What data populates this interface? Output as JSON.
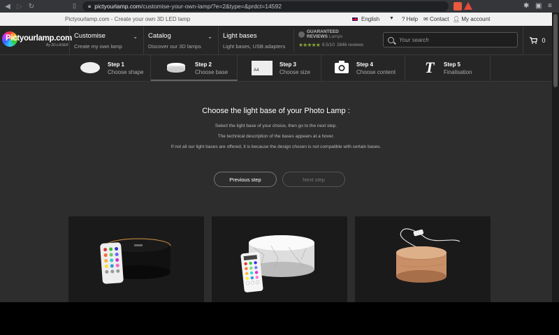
{
  "browser": {
    "url_host": "pictyourlamp.com",
    "url_path": "/customise-your-own-lamp/?e=2&type=&prdct=14592"
  },
  "topbar": {
    "tagline": "Pictyourlamp.com - Create your own 3D LED lamp",
    "language": "English",
    "help": "Help",
    "contact": "Contact",
    "account": "My account"
  },
  "header": {
    "logo": "Pictyourlamp.com",
    "logo_sub": "By 2D-LASER",
    "menus": [
      {
        "title": "Customise",
        "sub": "Create my own lamp"
      },
      {
        "title": "Catalog",
        "sub": "Discover our 3D lamps"
      },
      {
        "title": "Light bases",
        "sub": "Light bases, USB adapters"
      }
    ],
    "reviews": {
      "badge_line1": "GUARANTEED",
      "badge_line2": "REVIEWS",
      "brand": "Lamps",
      "score": "9.5/10",
      "count": "2846 reviews"
    },
    "search_placeholder": "Your search",
    "cart_count": "0"
  },
  "steps": [
    {
      "name": "Step 1",
      "desc": "Choose shape"
    },
    {
      "name": "Step 2",
      "desc": "Choose base"
    },
    {
      "name": "Step 3",
      "desc": "Choose size",
      "icon_label": "A4"
    },
    {
      "name": "Step 4",
      "desc": "Choose content"
    },
    {
      "name": "Step 5",
      "desc": "Finalisation",
      "icon_label": "T"
    }
  ],
  "content": {
    "title": "Choose the light base of your Photo Lamp :",
    "lines": [
      "Select the light base of your choice, then go to the next step.",
      "The technical description of the bases appears at a hover.",
      "If not all our light bases are offered, it is because the design chosen is not compatible with certain bases."
    ],
    "prev_label": "Previous step",
    "next_label": "Next step"
  }
}
